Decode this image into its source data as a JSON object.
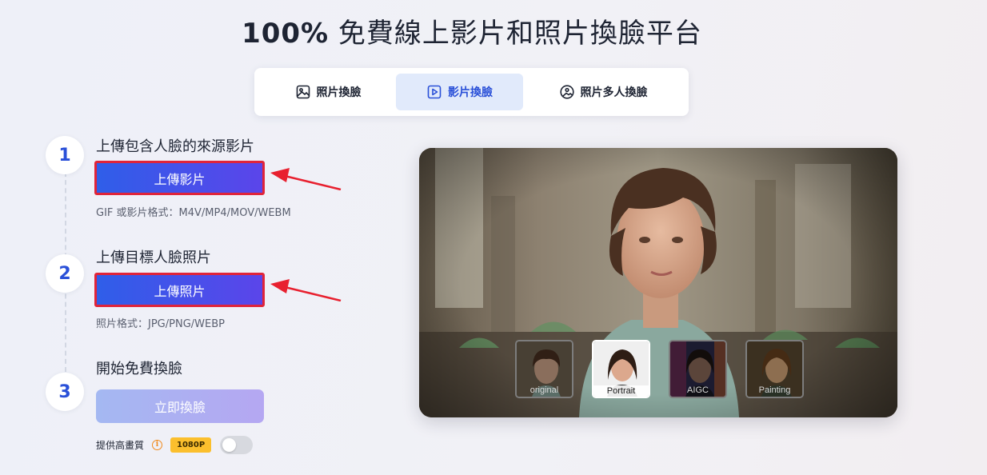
{
  "header": {
    "title_prefix": "100%",
    "title_rest": " 免費線上影片和照片換臉平台"
  },
  "tabs": [
    {
      "label": "照片換臉",
      "icon": "image-icon",
      "active": false
    },
    {
      "label": "影片換臉",
      "icon": "video-play-icon",
      "active": true
    },
    {
      "label": "照片多人換臉",
      "icon": "multi-face-image-icon",
      "active": false
    }
  ],
  "steps": [
    {
      "number": "1",
      "label": "上傳包含人臉的來源影片",
      "button": "上傳影片",
      "formats": "GIF 或影片格式：M4V/MP4/MOV/WEBM"
    },
    {
      "number": "2",
      "label": "上傳目標人臉照片",
      "button": "上傳照片",
      "formats": "照片格式：JPG/PNG/WEBP"
    },
    {
      "number": "3",
      "label": "開始免費換臉",
      "button": "立即換臉"
    }
  ],
  "quality": {
    "label": "提供高畫質",
    "info_icon": "info-icon",
    "badge": "1080P",
    "toggle_on": false
  },
  "preview": {
    "styles": [
      {
        "label": "original",
        "active": false
      },
      {
        "label": "Portrait",
        "active": true
      },
      {
        "label": "AIGC",
        "active": false
      },
      {
        "label": "Painting",
        "active": false
      }
    ]
  },
  "colors": {
    "accent": "#2a50d8",
    "button_gradient_start": "#2f5ee9",
    "button_gradient_end": "#5b45ea",
    "highlight_border": "#e0243a",
    "badge": "#fbbf2d"
  }
}
